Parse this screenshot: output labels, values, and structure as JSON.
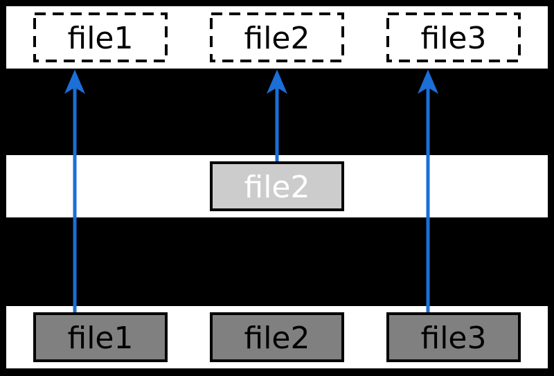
{
  "rows": {
    "top": {
      "boxes": [
        {
          "label": "file1"
        },
        {
          "label": "file2"
        },
        {
          "label": "file3"
        }
      ]
    },
    "middle": {
      "boxes": [
        {
          "label": "file2"
        }
      ]
    },
    "bottom": {
      "boxes": [
        {
          "label": "file1"
        },
        {
          "label": "file2"
        },
        {
          "label": "file3"
        }
      ]
    }
  },
  "arrows": [
    {
      "from": "bottom.file1",
      "to": "top.file1"
    },
    {
      "from": "middle.file2",
      "to": "top.file2"
    },
    {
      "from": "bottom.file3",
      "to": "top.file3"
    }
  ],
  "colors": {
    "arrow": "#1b6fd6",
    "box_dark": "#808080",
    "box_light": "#cccccc",
    "stroke": "#000000",
    "band": "#ffffff"
  }
}
